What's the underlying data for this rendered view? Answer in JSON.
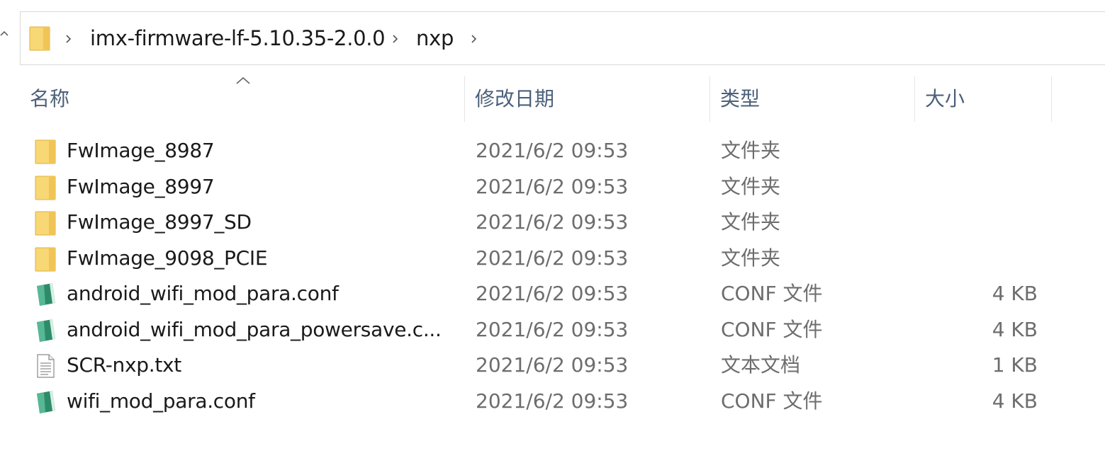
{
  "breadcrumb": {
    "items": [
      {
        "label": "imx-firmware-lf-5.10.35-2.0.0"
      },
      {
        "label": "nxp"
      }
    ]
  },
  "columns": {
    "name": "名称",
    "modified": "修改日期",
    "type": "类型",
    "size": "大小"
  },
  "sort": {
    "column": "name",
    "direction": "ascending"
  },
  "colors": {
    "folder_fill": "#f8d775",
    "folder_edge": "#e0b23c",
    "conf_icon": "#2e8b6a",
    "header_text": "#4c607a"
  },
  "files": [
    {
      "icon": "folder-icon",
      "name": "FwImage_8987",
      "modified": "2021/6/2 09:53",
      "type": "文件夹",
      "size": ""
    },
    {
      "icon": "folder-icon",
      "name": "FwImage_8997",
      "modified": "2021/6/2 09:53",
      "type": "文件夹",
      "size": ""
    },
    {
      "icon": "folder-icon",
      "name": "FwImage_8997_SD",
      "modified": "2021/6/2 09:53",
      "type": "文件夹",
      "size": ""
    },
    {
      "icon": "folder-icon",
      "name": "FwImage_9098_PCIE",
      "modified": "2021/6/2 09:53",
      "type": "文件夹",
      "size": ""
    },
    {
      "icon": "conf-file-icon",
      "name": "android_wifi_mod_para.conf",
      "modified": "2021/6/2 09:53",
      "type": "CONF 文件",
      "size": "4 KB"
    },
    {
      "icon": "conf-file-icon",
      "name": "android_wifi_mod_para_powersave.c...",
      "modified": "2021/6/2 09:53",
      "type": "CONF 文件",
      "size": "4 KB"
    },
    {
      "icon": "text-file-icon",
      "name": "SCR-nxp.txt",
      "modified": "2021/6/2 09:53",
      "type": "文本文档",
      "size": "1 KB"
    },
    {
      "icon": "conf-file-icon",
      "name": "wifi_mod_para.conf",
      "modified": "2021/6/2 09:53",
      "type": "CONF 文件",
      "size": "4 KB"
    }
  ]
}
